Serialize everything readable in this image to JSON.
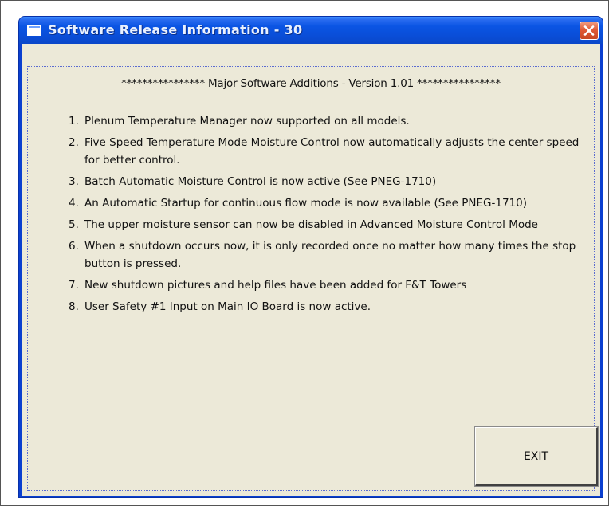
{
  "window": {
    "title": "Software Release Information - 30"
  },
  "content": {
    "heading": "**************** Major Software Additions - Version 1.01 ****************",
    "items": [
      {
        "num": "1.",
        "text": "Plenum Temperature Manager now supported on all models."
      },
      {
        "num": "2.",
        "text": "Five Speed Temperature Mode Moisture Control now automatically adjusts the center speed for better control."
      },
      {
        "num": "3.",
        "text": "Batch Automatic Moisture Control is now active (See PNEG-1710)"
      },
      {
        "num": "4.",
        "text": "An Automatic Startup for continuous flow mode is now available (See PNEG-1710)"
      },
      {
        "num": "5.",
        "text": "The upper moisture sensor can now be disabled in Advanced Moisture Control Mode"
      },
      {
        "num": "6.",
        "text": "When a shutdown occurs now, it is only recorded once no matter how many times the stop button is pressed."
      },
      {
        "num": "7.",
        "text": "New shutdown pictures and help files have been added for F&T Towers"
      },
      {
        "num": "8.",
        "text": "User Safety #1 Input on Main IO Board is now active."
      }
    ]
  },
  "buttons": {
    "exit_label": "EXIT"
  },
  "icons": {
    "window_icon": "window-icon",
    "close_icon": "close-icon"
  },
  "colors": {
    "titlebar": "#0a4ed8",
    "close_button": "#e05a36",
    "client_background": "#ece9d8"
  }
}
